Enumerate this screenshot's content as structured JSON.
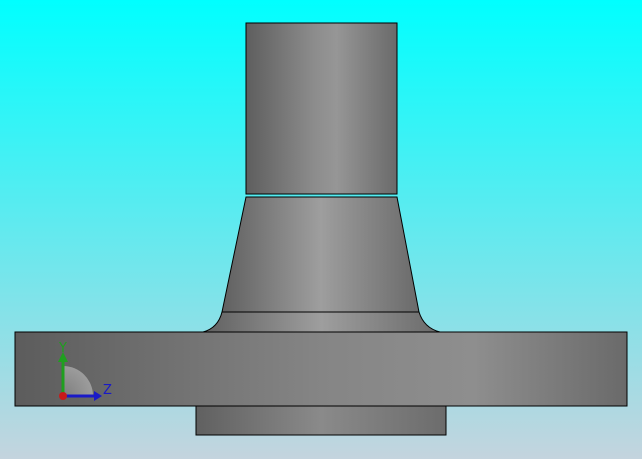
{
  "viewport": {
    "background": {
      "top_color": "#00FFFF",
      "bottom_color": "#C4D4DE"
    },
    "model": {
      "description_parts": [
        "neck-cylinder",
        "tapered-hub",
        "fillet",
        "flange-disc",
        "raised-face"
      ],
      "body_color_dark": "#5F5F5F",
      "body_color_light": "#9B9B9B",
      "edge_color": "#000000"
    },
    "triad": {
      "y_label": "Y",
      "z_label": "Z",
      "y_color": "#1F9F1F",
      "z_color": "#1A1AC8",
      "x_color": "#C81A1A"
    }
  }
}
